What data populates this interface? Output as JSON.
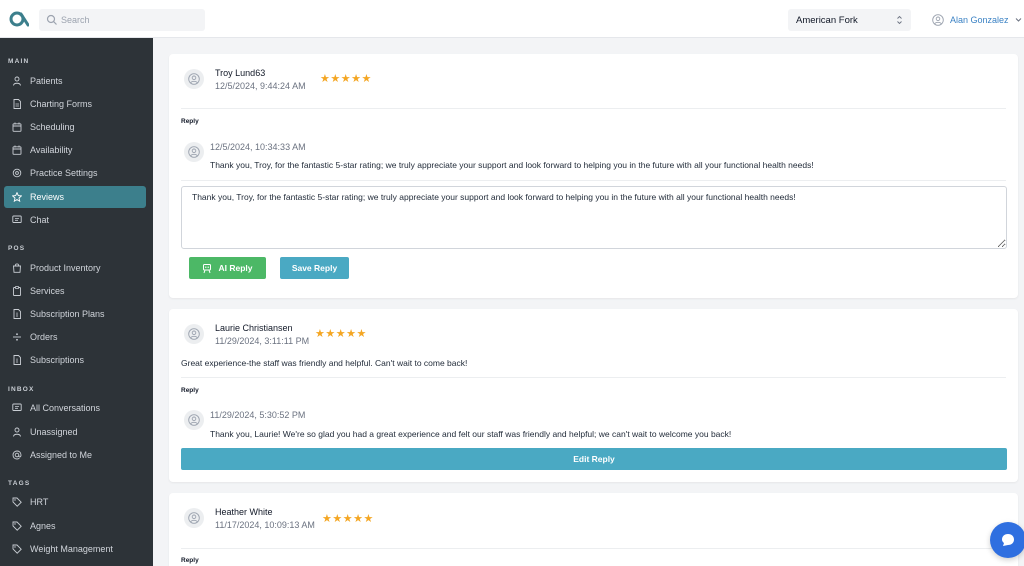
{
  "header": {
    "search_placeholder": "Search",
    "location": "American Fork",
    "user_name": "Alan Gonzalez"
  },
  "sidebar": {
    "sections": [
      {
        "title": "MAIN",
        "items": [
          {
            "label": "Patients",
            "icon": "person-icon"
          },
          {
            "label": "Charting Forms",
            "icon": "document-icon"
          },
          {
            "label": "Scheduling",
            "icon": "calendar-icon"
          },
          {
            "label": "Availability",
            "icon": "calendar-icon"
          },
          {
            "label": "Practice Settings",
            "icon": "gear-icon"
          },
          {
            "label": "Reviews",
            "icon": "star-icon",
            "active": true
          },
          {
            "label": "Chat",
            "icon": "chat-icon"
          }
        ]
      },
      {
        "title": "POS",
        "items": [
          {
            "label": "Product Inventory",
            "icon": "bag-icon"
          },
          {
            "label": "Services",
            "icon": "clipboard-icon"
          },
          {
            "label": "Subscription Plans",
            "icon": "document-dollar-icon"
          },
          {
            "label": "Orders",
            "icon": "divide-icon"
          },
          {
            "label": "Subscriptions",
            "icon": "document-dollar-icon"
          }
        ]
      },
      {
        "title": "INBOX",
        "items": [
          {
            "label": "All Conversations",
            "icon": "chat-icon"
          },
          {
            "label": "Unassigned",
            "icon": "person-icon"
          },
          {
            "label": "Assigned to Me",
            "icon": "at-icon"
          }
        ]
      },
      {
        "title": "TAGS",
        "items": [
          {
            "label": "HRT",
            "icon": "tag-icon"
          },
          {
            "label": "Agnes",
            "icon": "tag-icon"
          },
          {
            "label": "Weight Management",
            "icon": "tag-icon"
          }
        ]
      }
    ]
  },
  "reviews": [
    {
      "name": "Troy Lund63",
      "date": "12/5/2024, 9:44:24 AM",
      "stars": "★★★★★",
      "rating": 5,
      "comment": "",
      "reply_label": "Reply",
      "reply_date": "12/5/2024, 10:34:33 AM",
      "reply_text": "Thank you, Troy, for the fantastic 5-star rating; we truly appreciate your support and look forward to helping you in the future with all your functional health needs!",
      "textarea_value": "Thank you, Troy, for the fantastic 5-star rating; we truly appreciate your support and look forward to helping you in the future with all your functional health needs!",
      "ai_reply_label": "AI Reply",
      "save_reply_label": "Save Reply"
    },
    {
      "name": "Laurie Christiansen",
      "date": "11/29/2024, 3:11:11 PM",
      "stars": "★★★★★",
      "rating": 5,
      "comment": "Great experience-the staff was friendly and helpful. Can't wait to come back!",
      "reply_label": "Reply",
      "reply_date": "11/29/2024, 5:30:52 PM",
      "reply_text": "Thank you, Laurie! We're so glad you had a great experience and felt our staff was friendly and helpful; we can't wait to welcome you back!",
      "edit_reply_label": "Edit Reply"
    },
    {
      "name": "Heather White",
      "date": "11/17/2024, 10:09:13 AM",
      "stars": "★★★★★",
      "rating": 5,
      "reply_label": "Reply"
    }
  ]
}
